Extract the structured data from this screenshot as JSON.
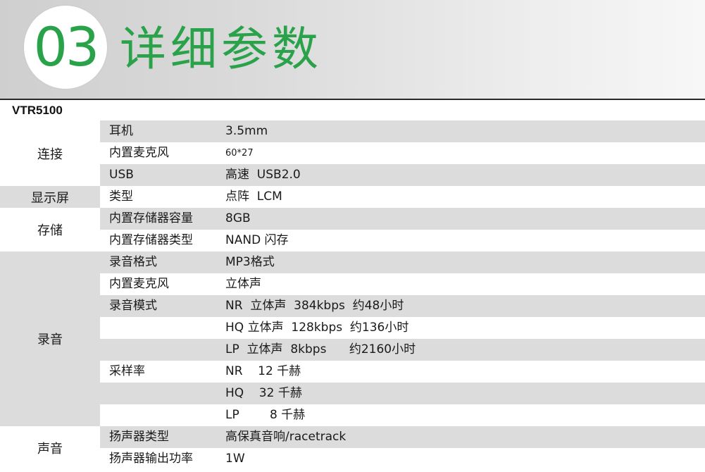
{
  "header": {
    "number": "03",
    "title": "详细参数"
  },
  "model": "VTR5100",
  "groups": [
    {
      "category": "连接",
      "rows": [
        {
          "key": "耳机",
          "value": "3.5mm"
        },
        {
          "key": "内置麦克风",
          "value": "60*27"
        },
        {
          "key": "USB",
          "value": "高速  USB2.0"
        }
      ]
    },
    {
      "category": "显示屏",
      "rows": [
        {
          "key": "类型",
          "value": "点阵  LCM"
        }
      ]
    },
    {
      "category": "存储",
      "rows": [
        {
          "key": "内置存储器容量",
          "value": "8GB"
        },
        {
          "key": "内置存储器类型",
          "value": "NAND 闪存"
        }
      ]
    },
    {
      "category": "录音",
      "rows": [
        {
          "key": "录音格式",
          "value": "MP3格式"
        },
        {
          "key": "内置麦克风",
          "value": "立体声"
        },
        {
          "key": "录音模式",
          "value": "NR  立体声  384kbps  约48小时"
        },
        {
          "key": "",
          "value": "HQ 立体声  128kbps  约136小时"
        },
        {
          "key": "",
          "value": "LP  立体声  8kbps      约2160小时"
        },
        {
          "key": "采样率",
          "value": "NR    12 千赫"
        },
        {
          "key": "",
          "value": "HQ    32 千赫"
        },
        {
          "key": "",
          "value": "LP        8 千赫"
        }
      ]
    },
    {
      "category": "声音",
      "rows": [
        {
          "key": "扬声器类型",
          "value": "高保真音响/racetrack"
        },
        {
          "key": "扬声器输出功率",
          "value": "1W"
        }
      ]
    }
  ]
}
